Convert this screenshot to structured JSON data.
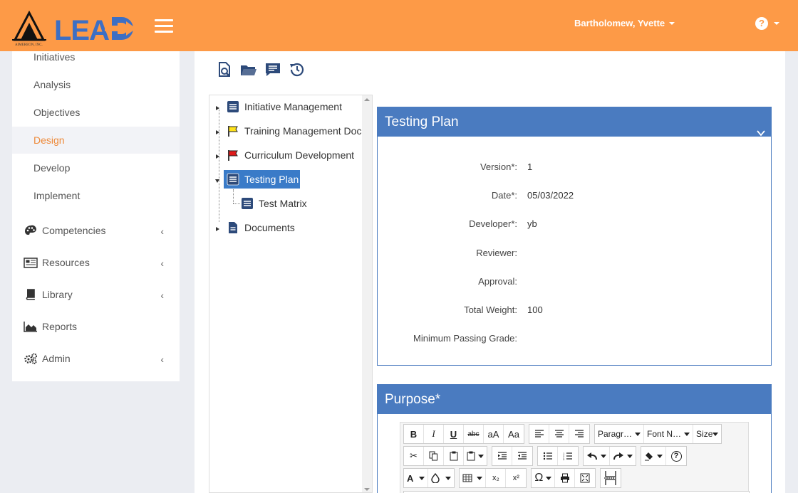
{
  "header": {
    "logo_text": "LEAD",
    "company_text": "AIMEREON, INC.",
    "user_name": "Bartholomew, Yvette",
    "help_symbol": "?"
  },
  "sidebar": {
    "sub_items": [
      {
        "label": "Initiatives"
      },
      {
        "label": "Analysis"
      },
      {
        "label": "Objectives"
      },
      {
        "label": "Design"
      },
      {
        "label": "Develop"
      },
      {
        "label": "Implement"
      }
    ],
    "main_items": [
      {
        "label": "Competencies",
        "icon": "palette-icon"
      },
      {
        "label": "Resources",
        "icon": "newspaper-icon"
      },
      {
        "label": "Library",
        "icon": "book-icon"
      },
      {
        "label": "Reports",
        "icon": "area-chart-icon"
      },
      {
        "label": "Admin",
        "icon": "gears-icon"
      }
    ],
    "active_item": "Design",
    "accent_color": "#ee8a3a"
  },
  "tree": {
    "nodes": [
      {
        "label": "Initiative Management",
        "icon": "document-list-icon"
      },
      {
        "label": "Training Management Doc",
        "icon": "yellow-flag-icon"
      },
      {
        "label": "Curriculum Development",
        "icon": "red-flag-icon"
      },
      {
        "label": "Testing Plan",
        "icon": "document-list-icon"
      },
      {
        "label": "Test Matrix",
        "icon": "document-list-icon"
      },
      {
        "label": "Documents",
        "icon": "file-icon"
      }
    ],
    "selected": "Testing Plan"
  },
  "testing_plan": {
    "title": "Testing Plan",
    "fields": [
      {
        "label": "Version*:",
        "value": "1"
      },
      {
        "label": "Date*:",
        "value": "05/03/2022"
      },
      {
        "label": "Developer*:",
        "value": "yb"
      },
      {
        "label": "Reviewer:",
        "value": ""
      },
      {
        "label": "Approval:",
        "value": ""
      },
      {
        "label": "Total Weight:",
        "value": "100"
      },
      {
        "label": "Minimum Passing Grade:",
        "value": ""
      }
    ]
  },
  "purpose": {
    "title": "Purpose*",
    "toolbar": {
      "bold": "B",
      "italic": "I",
      "underline": "U",
      "strike": "abc",
      "case_lower": "aA",
      "case_title": "Aa",
      "paragraph": "Paragr…",
      "font_name": "Font N…",
      "size": "Size",
      "font_color": "A",
      "subscript": "x₂",
      "superscript": "x²",
      "special_char": "Ω",
      "help": "?"
    }
  },
  "colors": {
    "header": "#fd9a47",
    "card_header": "#4a7bc0",
    "selection": "#3a7bc8",
    "logo_blue": "#3d6fc4"
  }
}
